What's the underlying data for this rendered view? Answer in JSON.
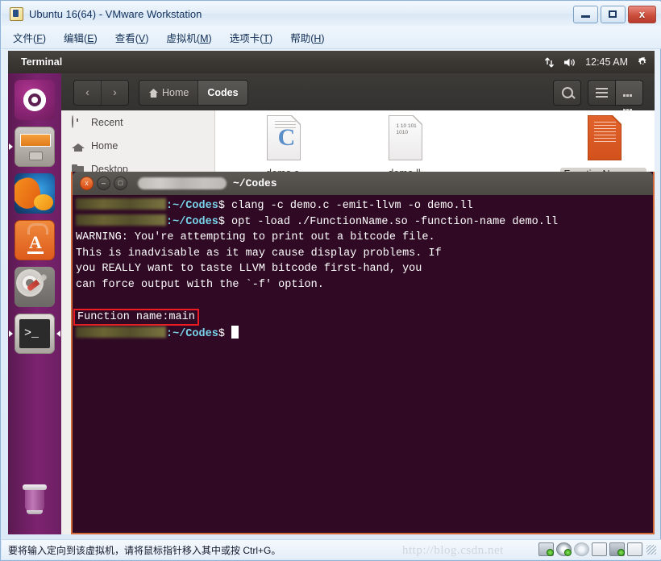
{
  "vmware": {
    "title": "Ubuntu 16(64) - VMware Workstation",
    "app_icon": "vmware-icon",
    "window_buttons": {
      "minimize": "minimize-button",
      "maximize": "maximize-button",
      "close_label": "x"
    },
    "menus": [
      {
        "label": "文件",
        "accel": "F"
      },
      {
        "label": "编辑",
        "accel": "E"
      },
      {
        "label": "查看",
        "accel": "V"
      },
      {
        "label": "虚拟机",
        "accel": "M"
      },
      {
        "label": "选项卡",
        "accel": "T"
      },
      {
        "label": "帮助",
        "accel": "H"
      }
    ],
    "status_text": "要将输入定向到该虚拟机，请将鼠标指针移入其中或按 Ctrl+G。",
    "watermark": "http://blog.csdn.net"
  },
  "ubuntu_panel": {
    "app_title": "Terminal",
    "indicators": [
      "network-icon",
      "volume-icon"
    ],
    "clock": "12:45 AM",
    "gear": "gear-icon"
  },
  "launcher": {
    "items": [
      {
        "name": "dash-home",
        "icon": "ubuntu-logo-icon",
        "selected": false
      },
      {
        "name": "files",
        "icon": "file-manager-icon",
        "selected": true
      },
      {
        "name": "firefox",
        "icon": "firefox-icon",
        "selected": false
      },
      {
        "name": "software-center",
        "icon": "software-center-icon",
        "selected": false
      },
      {
        "name": "system-settings",
        "icon": "system-settings-icon",
        "selected": false
      },
      {
        "name": "terminal",
        "icon": "terminal-icon",
        "selected": true
      }
    ],
    "trash": {
      "name": "trash",
      "icon": "trash-icon"
    }
  },
  "file_manager": {
    "nav": {
      "back": "‹",
      "forward": "›"
    },
    "breadcrumbs": [
      {
        "label": "Home",
        "icon": "home-icon",
        "active": false
      },
      {
        "label": "Codes",
        "icon": "",
        "active": true
      }
    ],
    "toolbar": {
      "search": "search-icon",
      "list_view": "list-view-icon",
      "grid_view": "grid-view-icon"
    },
    "sidebar": [
      {
        "label": "Recent",
        "icon": "clock-icon"
      },
      {
        "label": "Home",
        "icon": "home-icon"
      },
      {
        "label": "Desktop",
        "icon": "folder-icon"
      }
    ],
    "files": [
      {
        "name": "demo.c",
        "icon": "c-source-file-icon",
        "selected": false
      },
      {
        "name": "demo.ll",
        "icon": "text-file-icon",
        "selected": false
      },
      {
        "name": "FunctionName.so",
        "icon": "shared-object-file-icon",
        "selected": true
      }
    ],
    "binary_icon_text": "1\n10\n101\n1010"
  },
  "terminal": {
    "titlebar": {
      "close": "x",
      "minimize": "–",
      "maximize": "□",
      "user_redacted": "",
      "path": "~/Codes"
    },
    "lines": [
      {
        "type": "prompt",
        "user": "",
        "path": ":~/Codes",
        "dollar": "$",
        "command": " clang -c demo.c -emit-llvm -o demo.ll"
      },
      {
        "type": "prompt",
        "user": "",
        "path": ":~/Codes",
        "dollar": "$",
        "command": " opt -load ./FunctionName.so -function-name demo.ll"
      },
      {
        "type": "output",
        "text": "WARNING: You're attempting to print out a bitcode file."
      },
      {
        "type": "output",
        "text": "This is inadvisable as it may cause display problems. If"
      },
      {
        "type": "output",
        "text": "you REALLY want to taste LLVM bitcode first-hand, you"
      },
      {
        "type": "output",
        "text": "can force output with the `-f' option."
      },
      {
        "type": "blank",
        "text": ""
      },
      {
        "type": "highlight",
        "text": "Function name:main"
      },
      {
        "type": "prompt_cursor",
        "user": "",
        "path": ":~/Codes",
        "dollar": "$",
        "command": ""
      }
    ],
    "highlight_color": "#ed1c24",
    "background_color": "#300a24",
    "border_color": "#d2693a"
  }
}
